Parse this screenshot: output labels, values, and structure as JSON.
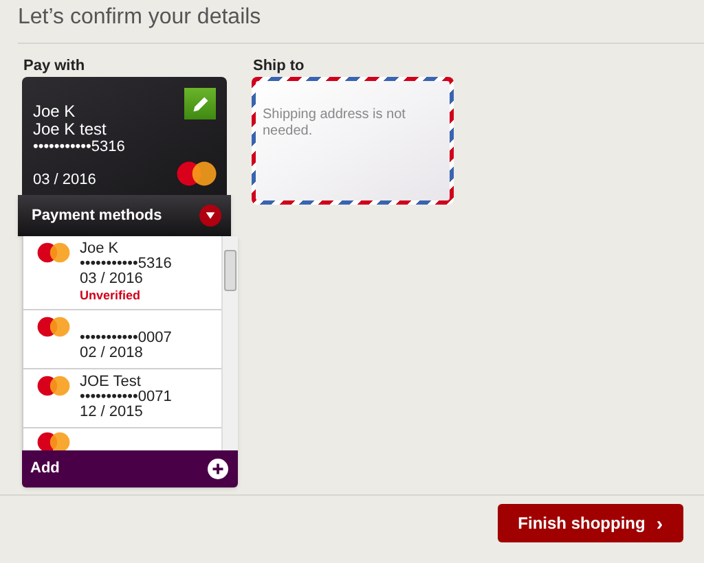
{
  "heading": "Let’s confirm your details",
  "pay_with": {
    "label": "Pay with",
    "card": {
      "name": "Joe K",
      "holder": "Joe K test",
      "number": "•••••••••••5316",
      "expiry": "03 / 2016"
    },
    "methods_toggle": {
      "label": "Payment methods",
      "expanded": true
    },
    "methods": [
      {
        "name": "Joe K",
        "number": "•••••••••••5316",
        "expiry": "03 / 2016",
        "status": "Unverified"
      },
      {
        "number": "•••••••••••0007",
        "expiry": "02 / 2018"
      },
      {
        "name": "JOE Test",
        "number": "•••••••••••0071",
        "expiry": "12 / 2015"
      },
      {
        "partial": true
      }
    ],
    "add_label": "Add"
  },
  "ship_to": {
    "label": "Ship to",
    "message": "Shipping address is not needed."
  },
  "finish_button": {
    "label": "Finish shopping",
    "icon": "›"
  }
}
